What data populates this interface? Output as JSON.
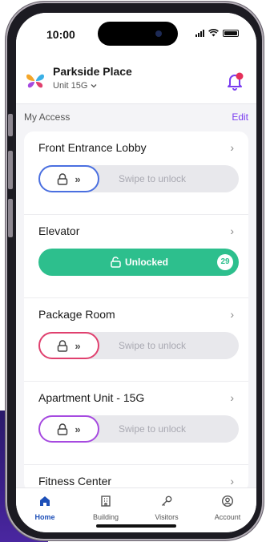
{
  "status": {
    "time": "10:00"
  },
  "header": {
    "property_name": "Parkside Place",
    "unit": "Unit 15G",
    "notification_dot_color": "#e5305a",
    "accent": "#7a3df0"
  },
  "access": {
    "section_title": "My Access",
    "edit_label": "Edit",
    "items": [
      {
        "title": "Front Entrance Lobby",
        "state": "locked",
        "action_label": "Swipe to unlock",
        "accent": "#4a6fe0"
      },
      {
        "title": "Elevator",
        "state": "unlocked",
        "action_label": "Unlocked",
        "count": "29",
        "accent": "#2dbf8d"
      },
      {
        "title": "Package Room",
        "state": "locked",
        "action_label": "Swipe to unlock",
        "accent": "#e0406e"
      },
      {
        "title": "Apartment Unit - 15G",
        "state": "locked",
        "action_label": "Swipe to unlock",
        "accent": "#a64ae0"
      },
      {
        "title": "Fitness Center",
        "state": "collapsed"
      }
    ]
  },
  "tabbar": {
    "tabs": [
      {
        "label": "Home",
        "icon": "home-icon",
        "active": true
      },
      {
        "label": "Building",
        "icon": "building-icon",
        "active": false
      },
      {
        "label": "Visitors",
        "icon": "key-icon",
        "active": false
      },
      {
        "label": "Account",
        "icon": "account-icon",
        "active": false
      }
    ],
    "active_color": "#1d4fb8"
  }
}
